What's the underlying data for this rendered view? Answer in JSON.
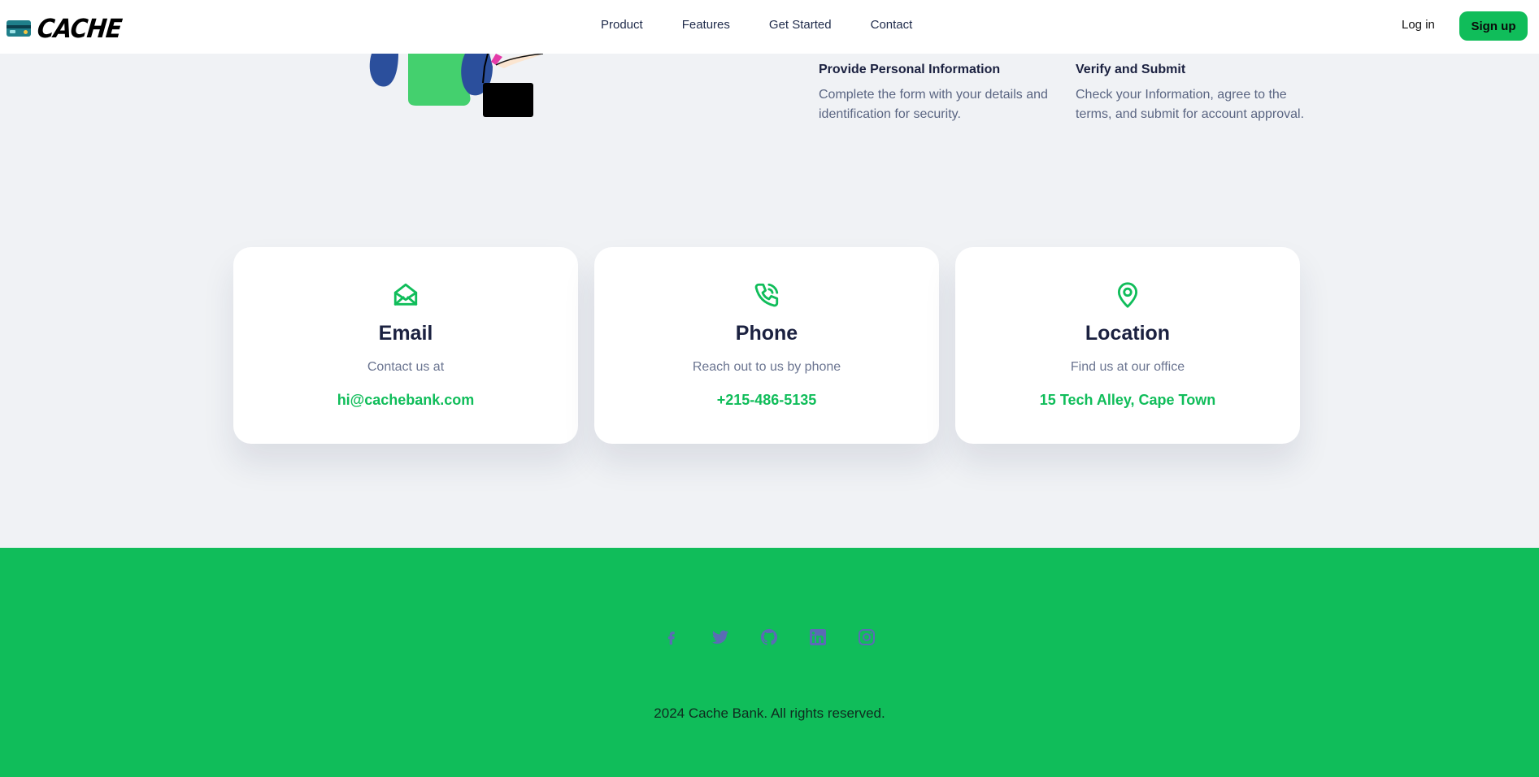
{
  "header": {
    "brand": "CACHE",
    "nav": [
      "Product",
      "Features",
      "Get Started",
      "Contact"
    ],
    "login_label": "Log in",
    "signup_label": "Sign up"
  },
  "steps": [
    {
      "title": "Provide Personal Information",
      "text": "Complete the form with your details and identification for security."
    },
    {
      "title": "Verify and Submit",
      "text": "Check your Information, agree to the terms, and submit for account approval."
    }
  ],
  "contacts": [
    {
      "title": "Email",
      "subtitle": "Contact us at",
      "value": "hi@cachebank.com",
      "icon": "mail-open-icon"
    },
    {
      "title": "Phone",
      "subtitle": "Reach out to us by phone",
      "value": "+215-486-5135",
      "icon": "phone-ringing-icon"
    },
    {
      "title": "Location",
      "subtitle": "Find us at our office",
      "value": "15 Tech Alley, Cape Town",
      "icon": "map-pin-icon"
    }
  ],
  "footer": {
    "social_icons": [
      "facebook-icon",
      "twitter-icon",
      "github-icon",
      "linkedin-icon",
      "instagram-icon"
    ],
    "copyright": "2024 Cache Bank. All rights reserved."
  },
  "colors": {
    "accent": "#10bd5a",
    "heading": "#1b2140",
    "muted": "#6b7591",
    "social_icon": "#5b6bb5",
    "background": "#f0f2f5"
  }
}
